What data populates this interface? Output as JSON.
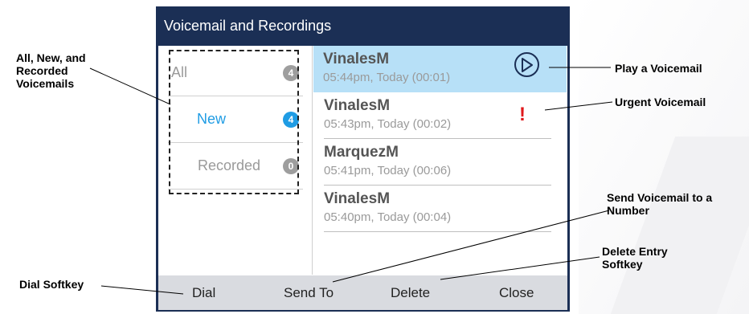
{
  "screen": {
    "title": "Voicemail and Recordings",
    "folders": [
      {
        "label": "All",
        "count": "4"
      },
      {
        "label": "New",
        "count": "4"
      },
      {
        "label": "Recorded",
        "count": "0"
      }
    ],
    "entries": [
      {
        "name": "VinalesM",
        "time": "05:44pm, Today (00:01)"
      },
      {
        "name": "VinalesM",
        "time": "05:43pm, Today (00:02)"
      },
      {
        "name": "MarquezM",
        "time": "05:41pm, Today (00:06)"
      },
      {
        "name": "VinalesM",
        "time": "05:40pm, Today (00:04)"
      }
    ],
    "urgent_mark": "!",
    "softkeys": {
      "dial": "Dial",
      "send_to": "Send To",
      "delete": "Delete",
      "close": "Close"
    }
  },
  "callouts": {
    "folders": "All, New, and Recorded Voicemails",
    "play": "Play a Voicemail",
    "urgent": "Urgent Voicemail",
    "send": "Send Voicemail to a Number",
    "delete": "Delete Entry Softkey",
    "dial": "Dial Softkey"
  },
  "colors": {
    "titlebar": "#1b2f55",
    "selected_row": "#b7e0f7",
    "accent": "#1f9ce4",
    "urgent": "#e0191c"
  }
}
